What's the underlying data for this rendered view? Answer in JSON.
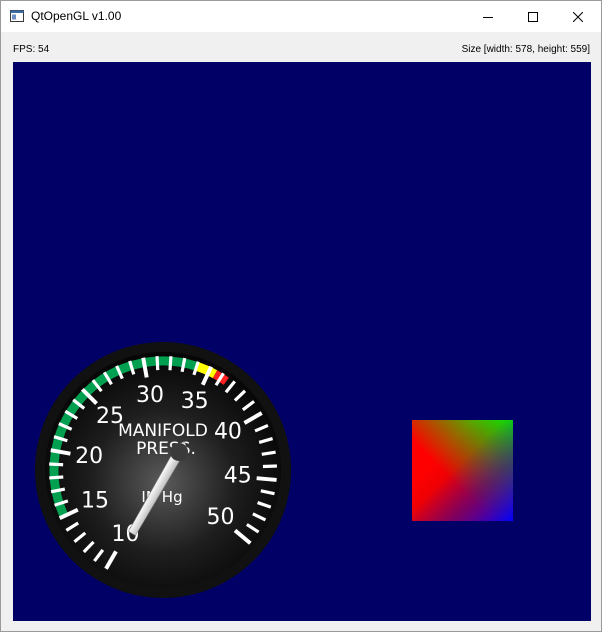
{
  "window": {
    "title": "QtOpenGL v1.00",
    "icon": "app-window-icon",
    "controls": {
      "minimize": "minimize-icon",
      "maximize": "maximize-icon",
      "close": "close-icon"
    }
  },
  "status": {
    "fps": "FPS: 54",
    "size": "Size [width: 578, height: 559]"
  },
  "gl": {
    "background_color": "#000066",
    "gauge": {
      "label_line1": "MANIFOLD",
      "label_line2": "PRESS.",
      "unit": "IN Hg",
      "scale_min": 10,
      "scale_max": 50,
      "labels": [
        "10",
        "15",
        "20",
        "25",
        "30",
        "35",
        "40",
        "45",
        "50"
      ],
      "needle_value": 10,
      "arcs": {
        "green": {
          "from": 15,
          "to": 34,
          "color": "#00a050"
        },
        "yellow": {
          "from": 34,
          "to": 35.5,
          "color": "#ffff00"
        },
        "red": {
          "from": 35.5,
          "to": 36.5,
          "color": "#ff2020"
        }
      }
    },
    "quad": {
      "colors": {
        "top_left": "#ff0000",
        "top_right": "#00ff00",
        "bottom_right": "#0000ff",
        "bottom_left": "#ff0000"
      }
    }
  }
}
